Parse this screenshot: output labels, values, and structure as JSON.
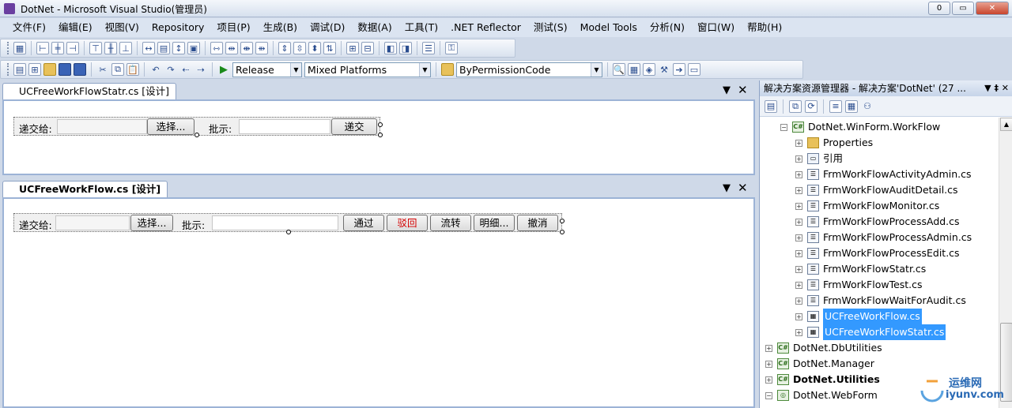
{
  "window": {
    "title": "DotNet - Microsoft Visual Studio(管理员)",
    "minimize": "0",
    "restore": "▭",
    "close": "✕"
  },
  "menu": [
    "文件(F)",
    "编辑(E)",
    "视图(V)",
    "Repository",
    "项目(P)",
    "生成(B)",
    "调试(D)",
    "数据(A)",
    "工具(T)",
    ".NET Reflector",
    "测试(S)",
    "Model Tools",
    "分析(N)",
    "窗口(W)",
    "帮助(H)"
  ],
  "toolbar": {
    "config": "Release",
    "platform": "Mixed Platforms",
    "find": "ByPermissionCode",
    "dropdown_arrow": "▼"
  },
  "doc1": {
    "tab": "UCFreeWorkFlowStatr.cs [设计]",
    "to_label": "递交给:",
    "select_btn": "选择...",
    "comment_label": "批示:",
    "submit_btn": "递交"
  },
  "doc2": {
    "tab": "UCFreeWorkFlow.cs [设计]",
    "to_label": "递交给:",
    "select_btn": "选择...",
    "comment_label": "批示:",
    "btn_pass": "通过",
    "btn_reject": "驳回",
    "btn_transfer": "流转",
    "btn_detail": "明细...",
    "btn_cancel": "撤消"
  },
  "tab_ctrls": {
    "dropdown": "▼",
    "close": "✕"
  },
  "solution": {
    "title": "解决方案资源管理器 - 解决方案'DotNet' (27 ...",
    "title_ctrls": "▼ ‡ ✕",
    "nodes": [
      "DotNet.WinForm.WorkFlow",
      "Properties",
      "引用",
      "FrmWorkFlowActivityAdmin.cs",
      "FrmWorkFlowAuditDetail.cs",
      "FrmWorkFlowMonitor.cs",
      "FrmWorkFlowProcessAdd.cs",
      "FrmWorkFlowProcessAdmin.cs",
      "FrmWorkFlowProcessEdit.cs",
      "FrmWorkFlowStatr.cs",
      "FrmWorkFlowTest.cs",
      "FrmWorkFlowWaitForAudit.cs",
      "UCFreeWorkFlow.cs",
      "UCFreeWorkFlowStatr.cs",
      "DotNet.DbUtilities",
      "DotNet.Manager",
      "DotNet.Utilities",
      "DotNet.WebForm"
    ],
    "expand_minus": "−",
    "expand_plus": "+"
  },
  "watermark": {
    "line1": "运维网",
    "line2": "iyunv.com"
  }
}
